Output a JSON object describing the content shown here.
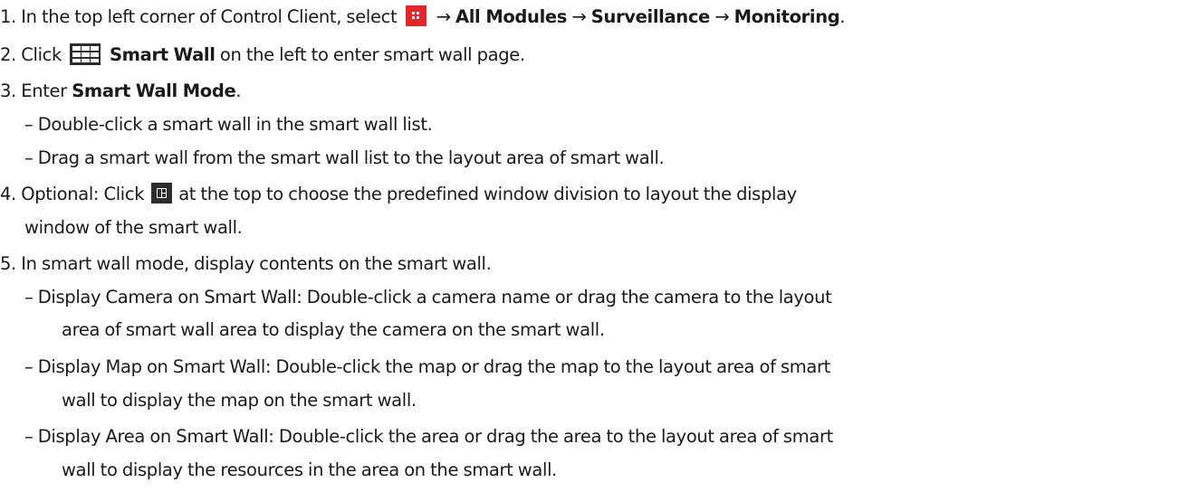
{
  "instructions": {
    "step1": {
      "prefix": "1. In the top left corner of Control Client, select",
      "icon": "all-modules-icon",
      "arrow1": "→",
      "all_modules": "All Modules",
      "arrow2": "→",
      "surveillance": "Surveillance",
      "arrow3": "→",
      "monitoring": "Monitoring",
      "suffix": "."
    },
    "step2": {
      "prefix": "2. Click",
      "icon": "smart-wall-icon",
      "smart_wall": "Smart Wall",
      "suffix": " on the left to enter smart wall page."
    },
    "step3": {
      "prefix": "3. Enter ",
      "mode": "Smart Wall Mode",
      "suffix": ".",
      "bullets": [
        "– Double-click a smart wall in the smart wall list.",
        "– Drag a smart wall from the smart wall list to the layout area of smart wall."
      ]
    },
    "step4": {
      "prefix": "4. Optional: Click",
      "icon": "window-division-icon",
      "suffix": "at the top to choose the predefined window division to layout the display",
      "continuation": "window of the smart wall."
    },
    "step5": {
      "text": "5. In smart wall mode, display contents on the smart wall.",
      "bullets": [
        {
          "line1": "– Display Camera on Smart Wall: Double-click a camera name or drag the camera to the layout",
          "line2": "area of smart wall area to display the camera on the smart wall."
        },
        {
          "line1": "– Display Map on Smart Wall: Double-click the map or drag the map to the layout area of smart",
          "line2": "wall to display the map on the smart wall."
        },
        {
          "line1": "– Display Area on Smart Wall: Double-click the area or drag the area to the layout area of smart",
          "line2": "wall to display the resources in the area on the smart wall."
        }
      ]
    }
  },
  "colors": {
    "text": "#1a1a1a",
    "modules_icon_bg": "#e3262b",
    "dark_icon_bg": "#2b2b2b"
  }
}
